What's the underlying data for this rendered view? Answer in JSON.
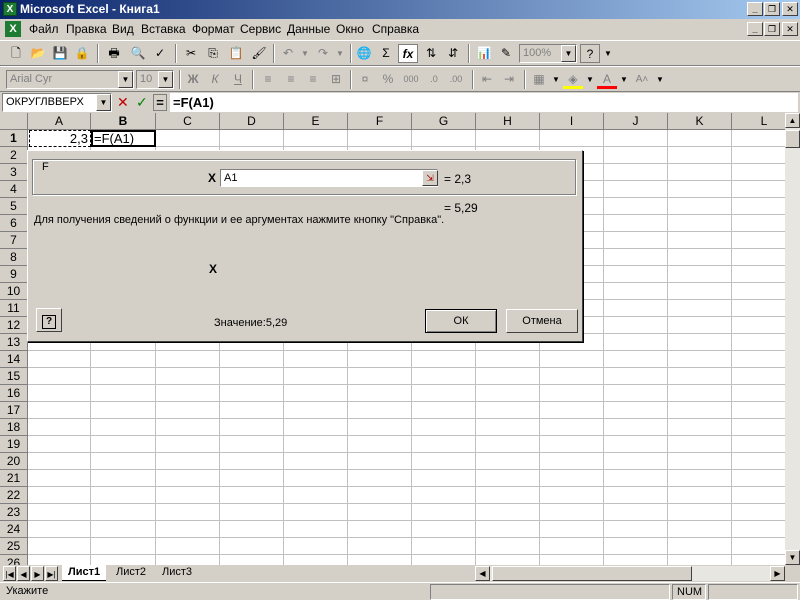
{
  "window": {
    "title": "Microsoft Excel - Книга1",
    "icon": "excel-icon"
  },
  "menu": {
    "items": [
      "Файл",
      "Правка",
      "Вид",
      "Вставка",
      "Формат",
      "Сервис",
      "Данные",
      "Окно",
      "Справка"
    ]
  },
  "toolbar": {
    "zoom": "100%",
    "font_name": "Arial Cyr",
    "font_size": "10",
    "bold": "Ж",
    "italic": "К",
    "underline": "Ч",
    "sum": "Σ",
    "function": "fx",
    "percent": "%",
    "thousands": "000"
  },
  "formula_bar": {
    "name_box": "ОКРУГЛВВЕРХ",
    "equals": "=",
    "formula": "=F(A1)"
  },
  "grid": {
    "columns": [
      "A",
      "B",
      "C",
      "D",
      "E",
      "F",
      "G",
      "H",
      "I",
      "J",
      "K",
      "L"
    ],
    "rows": [
      "1",
      "2",
      "3",
      "4",
      "5",
      "6",
      "7",
      "8",
      "9",
      "10",
      "11",
      "12",
      "13",
      "14",
      "15",
      "16",
      "17",
      "18",
      "19",
      "20",
      "21",
      "22",
      "23",
      "24",
      "25",
      "26"
    ],
    "cell_a1": "2,3",
    "cell_b1": "=F(A1)"
  },
  "dialog": {
    "group_label": "F",
    "arg_label": "X",
    "arg_value": "A1",
    "arg_result": "= 2,3",
    "function_result": "= 5,29",
    "description": "Для получения сведений о функции и ее аргументах нажмите кнопку \"Справка\".",
    "arg_description_label": "X",
    "value_label": "Значение:5,29",
    "help_label": "?",
    "ok_label": "ОК",
    "cancel_label": "Отмена"
  },
  "sheets": {
    "tabs": [
      "Лист1",
      "Лист2",
      "Лист3"
    ],
    "active": "Лист1"
  },
  "status": {
    "mode": "Укажите",
    "num": "NUM"
  },
  "colors": {
    "title_bar": "#0a246a",
    "chrome": "#d4d0c8",
    "excel_green": "#1e7b34"
  }
}
